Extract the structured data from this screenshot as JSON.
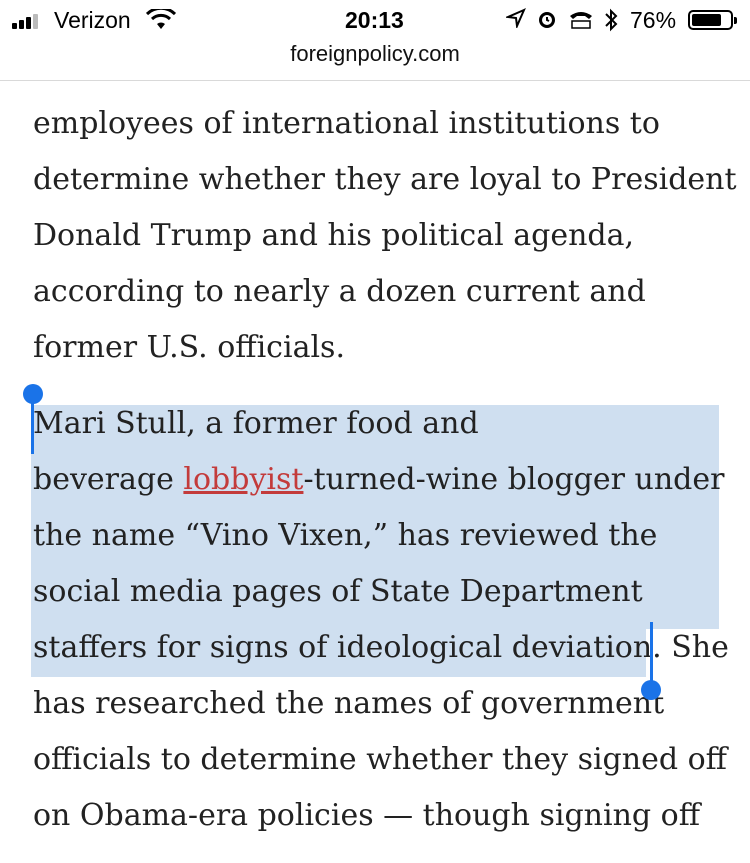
{
  "status": {
    "carrier": "Verizon",
    "time": "20:13",
    "battery": "76%",
    "icons": [
      "signal-icon",
      "wifi-icon",
      "location-icon",
      "alarm-icon",
      "tty-icon",
      "bluetooth-icon",
      "battery-icon"
    ]
  },
  "browser": {
    "url": "foreignpolicy.com"
  },
  "article": {
    "p1": [
      "employees of international institutions to",
      "determine whether they are loyal to President",
      "Donald Trump and his political agenda,",
      "according to nearly a dozen current and",
      "former U.S. officials."
    ],
    "p2_line1": "Mari Stull, a former food and",
    "p2_line2_before": "beverage ",
    "p2_link": "lobbyist",
    "p2_line2_after": "-turned-wine blogger under",
    "p2_line3": "the name “Vino Vixen,” has reviewed the",
    "p2_line4": "social media pages of State Department",
    "p2_line5_selected": "staffers for signs of ideological deviation.",
    "p2_line5_rest": " She",
    "p2_line6": "has researched the names of government",
    "p2_line7": "officials to determine whether they signed off",
    "p2_line8": "on Obama-era policies — though signing off"
  },
  "colors": {
    "selection": "#cfdff0",
    "handle": "#1a73e8",
    "link": "#c33b3b"
  }
}
